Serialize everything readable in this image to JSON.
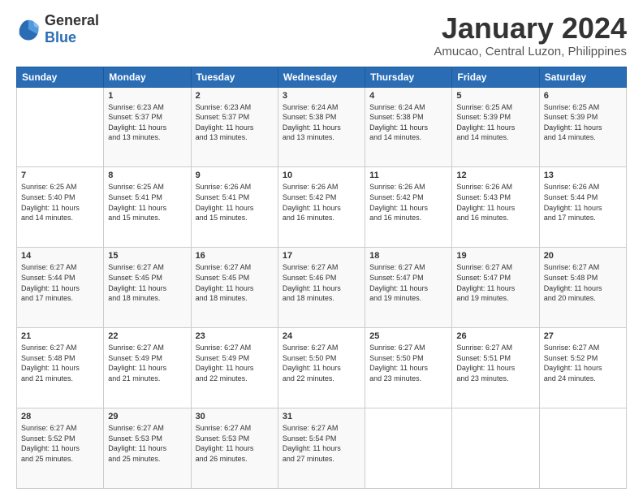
{
  "header": {
    "logo_general": "General",
    "logo_blue": "Blue",
    "month_title": "January 2024",
    "location": "Amucao, Central Luzon, Philippines"
  },
  "weekdays": [
    "Sunday",
    "Monday",
    "Tuesday",
    "Wednesday",
    "Thursday",
    "Friday",
    "Saturday"
  ],
  "weeks": [
    [
      {
        "day": "",
        "content": ""
      },
      {
        "day": "1",
        "content": "Sunrise: 6:23 AM\nSunset: 5:37 PM\nDaylight: 11 hours\nand 13 minutes."
      },
      {
        "day": "2",
        "content": "Sunrise: 6:23 AM\nSunset: 5:37 PM\nDaylight: 11 hours\nand 13 minutes."
      },
      {
        "day": "3",
        "content": "Sunrise: 6:24 AM\nSunset: 5:38 PM\nDaylight: 11 hours\nand 13 minutes."
      },
      {
        "day": "4",
        "content": "Sunrise: 6:24 AM\nSunset: 5:38 PM\nDaylight: 11 hours\nand 14 minutes."
      },
      {
        "day": "5",
        "content": "Sunrise: 6:25 AM\nSunset: 5:39 PM\nDaylight: 11 hours\nand 14 minutes."
      },
      {
        "day": "6",
        "content": "Sunrise: 6:25 AM\nSunset: 5:39 PM\nDaylight: 11 hours\nand 14 minutes."
      }
    ],
    [
      {
        "day": "7",
        "content": "Sunrise: 6:25 AM\nSunset: 5:40 PM\nDaylight: 11 hours\nand 14 minutes."
      },
      {
        "day": "8",
        "content": "Sunrise: 6:25 AM\nSunset: 5:41 PM\nDaylight: 11 hours\nand 15 minutes."
      },
      {
        "day": "9",
        "content": "Sunrise: 6:26 AM\nSunset: 5:41 PM\nDaylight: 11 hours\nand 15 minutes."
      },
      {
        "day": "10",
        "content": "Sunrise: 6:26 AM\nSunset: 5:42 PM\nDaylight: 11 hours\nand 16 minutes."
      },
      {
        "day": "11",
        "content": "Sunrise: 6:26 AM\nSunset: 5:42 PM\nDaylight: 11 hours\nand 16 minutes."
      },
      {
        "day": "12",
        "content": "Sunrise: 6:26 AM\nSunset: 5:43 PM\nDaylight: 11 hours\nand 16 minutes."
      },
      {
        "day": "13",
        "content": "Sunrise: 6:26 AM\nSunset: 5:44 PM\nDaylight: 11 hours\nand 17 minutes."
      }
    ],
    [
      {
        "day": "14",
        "content": "Sunrise: 6:27 AM\nSunset: 5:44 PM\nDaylight: 11 hours\nand 17 minutes."
      },
      {
        "day": "15",
        "content": "Sunrise: 6:27 AM\nSunset: 5:45 PM\nDaylight: 11 hours\nand 18 minutes."
      },
      {
        "day": "16",
        "content": "Sunrise: 6:27 AM\nSunset: 5:45 PM\nDaylight: 11 hours\nand 18 minutes."
      },
      {
        "day": "17",
        "content": "Sunrise: 6:27 AM\nSunset: 5:46 PM\nDaylight: 11 hours\nand 18 minutes."
      },
      {
        "day": "18",
        "content": "Sunrise: 6:27 AM\nSunset: 5:47 PM\nDaylight: 11 hours\nand 19 minutes."
      },
      {
        "day": "19",
        "content": "Sunrise: 6:27 AM\nSunset: 5:47 PM\nDaylight: 11 hours\nand 19 minutes."
      },
      {
        "day": "20",
        "content": "Sunrise: 6:27 AM\nSunset: 5:48 PM\nDaylight: 11 hours\nand 20 minutes."
      }
    ],
    [
      {
        "day": "21",
        "content": "Sunrise: 6:27 AM\nSunset: 5:48 PM\nDaylight: 11 hours\nand 21 minutes."
      },
      {
        "day": "22",
        "content": "Sunrise: 6:27 AM\nSunset: 5:49 PM\nDaylight: 11 hours\nand 21 minutes."
      },
      {
        "day": "23",
        "content": "Sunrise: 6:27 AM\nSunset: 5:49 PM\nDaylight: 11 hours\nand 22 minutes."
      },
      {
        "day": "24",
        "content": "Sunrise: 6:27 AM\nSunset: 5:50 PM\nDaylight: 11 hours\nand 22 minutes."
      },
      {
        "day": "25",
        "content": "Sunrise: 6:27 AM\nSunset: 5:50 PM\nDaylight: 11 hours\nand 23 minutes."
      },
      {
        "day": "26",
        "content": "Sunrise: 6:27 AM\nSunset: 5:51 PM\nDaylight: 11 hours\nand 23 minutes."
      },
      {
        "day": "27",
        "content": "Sunrise: 6:27 AM\nSunset: 5:52 PM\nDaylight: 11 hours\nand 24 minutes."
      }
    ],
    [
      {
        "day": "28",
        "content": "Sunrise: 6:27 AM\nSunset: 5:52 PM\nDaylight: 11 hours\nand 25 minutes."
      },
      {
        "day": "29",
        "content": "Sunrise: 6:27 AM\nSunset: 5:53 PM\nDaylight: 11 hours\nand 25 minutes."
      },
      {
        "day": "30",
        "content": "Sunrise: 6:27 AM\nSunset: 5:53 PM\nDaylight: 11 hours\nand 26 minutes."
      },
      {
        "day": "31",
        "content": "Sunrise: 6:27 AM\nSunset: 5:54 PM\nDaylight: 11 hours\nand 27 minutes."
      },
      {
        "day": "",
        "content": ""
      },
      {
        "day": "",
        "content": ""
      },
      {
        "day": "",
        "content": ""
      }
    ]
  ]
}
